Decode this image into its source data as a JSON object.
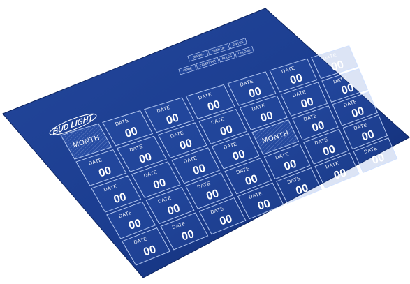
{
  "brand": {
    "logo_text": "BUD LIGHT",
    "colors": {
      "background": "#1a3c8c",
      "background_edge": "#0f2868",
      "grid_line": "#cddeff",
      "text": "#ffffff"
    }
  },
  "nav": {
    "row1": [
      "SIGN IN",
      "SIGN UP",
      "EN | ES"
    ],
    "row2": [
      "HOME",
      "CALENDAR",
      "RULES",
      "UPLOAD"
    ]
  },
  "calendar": {
    "date_label": "DATE",
    "day_value": "00",
    "month_label": "MONTH",
    "rows": [
      [
        "month",
        "date",
        "date",
        "date",
        "date",
        "date",
        "date"
      ],
      [
        "date",
        "date",
        "date",
        "date",
        "date",
        "date",
        "date"
      ],
      [
        "date",
        "date",
        "date",
        "date",
        "month",
        "date",
        "date"
      ],
      [
        "date",
        "date",
        "date",
        "date",
        "date",
        "date",
        "date"
      ],
      [
        "date",
        "date",
        "date",
        "date",
        "date",
        "date",
        "date"
      ]
    ]
  }
}
